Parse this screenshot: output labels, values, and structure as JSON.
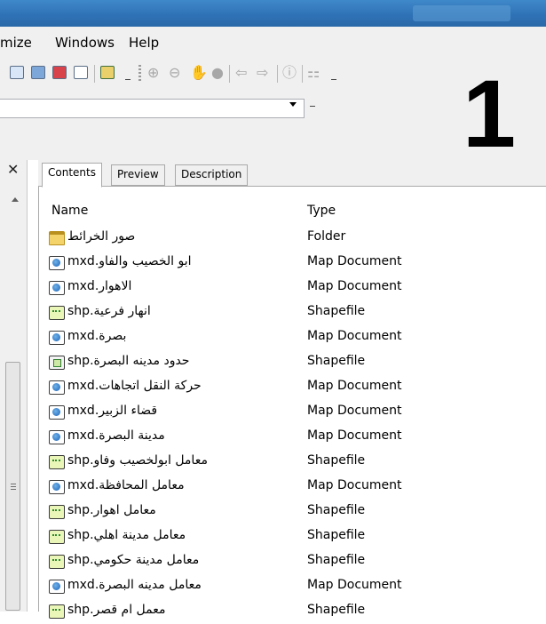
{
  "menu": [
    "mize",
    "Windows",
    "Help"
  ],
  "toolbar": {
    "icons": [
      "layer-icon",
      "catalog-icon",
      "toolbox-icon",
      "python-window-icon",
      "model-builder-icon",
      "zoom-in-icon",
      "zoom-out-icon",
      "pan-hand-icon",
      "full-extent-icon",
      "back-arrow-icon",
      "forward-arrow-icon",
      "identify-icon",
      "overview-icon"
    ]
  },
  "annotation": {
    "number": "1"
  },
  "tabs": {
    "contents": "Contents",
    "preview": "Preview",
    "description": "Description"
  },
  "columns": {
    "name": "Name",
    "type": "Type"
  },
  "rows": [
    {
      "name": "صور الخرائط",
      "type": "Folder",
      "icon": "folder"
    },
    {
      "name": "ابو الخصيب والفاو.mxd",
      "type": "Map Document",
      "icon": "map"
    },
    {
      "name": "الاهوار.mxd",
      "type": "Map Document",
      "icon": "map"
    },
    {
      "name": "انهار فرعية.shp",
      "type": "Shapefile",
      "icon": "line"
    },
    {
      "name": "بصرة.mxd",
      "type": "Map Document",
      "icon": "map"
    },
    {
      "name": "حدود مدينه البصرة.shp",
      "type": "Shapefile",
      "icon": "poly"
    },
    {
      "name": "حركة النقل اتجاهات.mxd",
      "type": "Map Document",
      "icon": "map"
    },
    {
      "name": "قضاء الزبير.mxd",
      "type": "Map Document",
      "icon": "map"
    },
    {
      "name": "مدينة البصرة.mxd",
      "type": "Map Document",
      "icon": "map"
    },
    {
      "name": "معامل ابولخصيب وفاو.shp",
      "type": "Shapefile",
      "icon": "point"
    },
    {
      "name": "معامل المحافظة.mxd",
      "type": "Map Document",
      "icon": "map"
    },
    {
      "name": "معامل اهوار.shp",
      "type": "Shapefile",
      "icon": "point"
    },
    {
      "name": "معامل مدينة اهلي.shp",
      "type": "Shapefile",
      "icon": "point"
    },
    {
      "name": "معامل مدينة حكومي.shp",
      "type": "Shapefile",
      "icon": "point"
    },
    {
      "name": "معامل مدينه البصرة.mxd",
      "type": "Map Document",
      "icon": "map"
    },
    {
      "name": "معمل ام قصر.shp",
      "type": "Shapefile",
      "icon": "point"
    }
  ]
}
